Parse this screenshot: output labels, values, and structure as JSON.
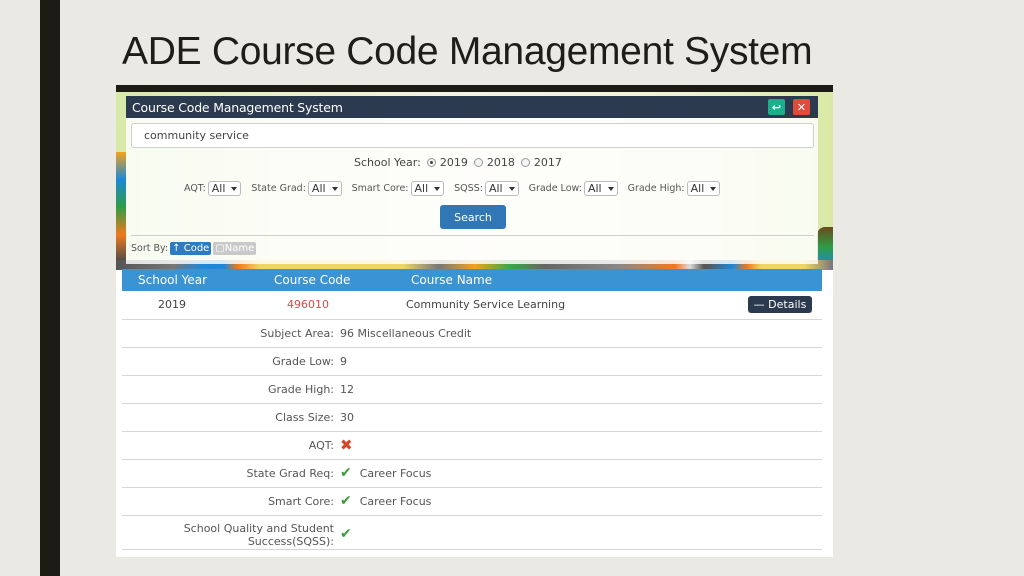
{
  "slide": {
    "title": "ADE Course Code Management System"
  },
  "app": {
    "title": "Course Code Management System",
    "header_buttons": {
      "back_icon": "back-arrow-icon",
      "close_icon": "close-icon",
      "close_glyph": "✕",
      "back_glyph": "↩"
    },
    "colors": {
      "header": "#2b3a4f",
      "accent": "#3a93d3",
      "code": "#d84a4a",
      "check": "#3b9a3b",
      "cross": "#d4472a"
    }
  },
  "search": {
    "value": "community service",
    "button_label": "Search"
  },
  "school_year": {
    "label": "School Year:",
    "options": [
      {
        "label": "2019",
        "selected": true
      },
      {
        "label": "2018",
        "selected": false
      },
      {
        "label": "2017",
        "selected": false
      }
    ]
  },
  "filters": [
    {
      "label": "AQT:",
      "value": "All"
    },
    {
      "label": "State Grad:",
      "value": "All"
    },
    {
      "label": "Smart Core:",
      "value": "All"
    },
    {
      "label": "SQSS:",
      "value": "All"
    },
    {
      "label": "Grade Low:",
      "value": "All"
    },
    {
      "label": "Grade High:",
      "value": "All"
    }
  ],
  "sort": {
    "label": "Sort By:",
    "options": [
      {
        "label": "↑ Code",
        "active": true
      },
      {
        "label": "▢Name",
        "active": false
      }
    ]
  },
  "results": {
    "columns": [
      "School Year",
      "Course Code",
      "Course Name"
    ],
    "rows": [
      {
        "school_year": "2019",
        "course_code": "496010",
        "course_name": "Community Service Learning",
        "details_label": "— Details"
      }
    ],
    "details": [
      {
        "label": "Subject Area:",
        "value": "96 Miscellaneous Credit",
        "icon": ""
      },
      {
        "label": "Grade Low:",
        "value": "9",
        "icon": ""
      },
      {
        "label": "Grade High:",
        "value": "12",
        "icon": ""
      },
      {
        "label": "Class Size:",
        "value": "30",
        "icon": ""
      },
      {
        "label": "AQT:",
        "value": "",
        "icon": "x-mark-icon"
      },
      {
        "label": "State Grad Req:",
        "value": "Career Focus",
        "icon": "check-icon"
      },
      {
        "label": "Smart Core:",
        "value": "Career Focus",
        "icon": "check-icon"
      },
      {
        "label": "School Quality and Student",
        "label2": "Success(SQSS):",
        "value": "",
        "icon": "check-icon"
      }
    ]
  }
}
